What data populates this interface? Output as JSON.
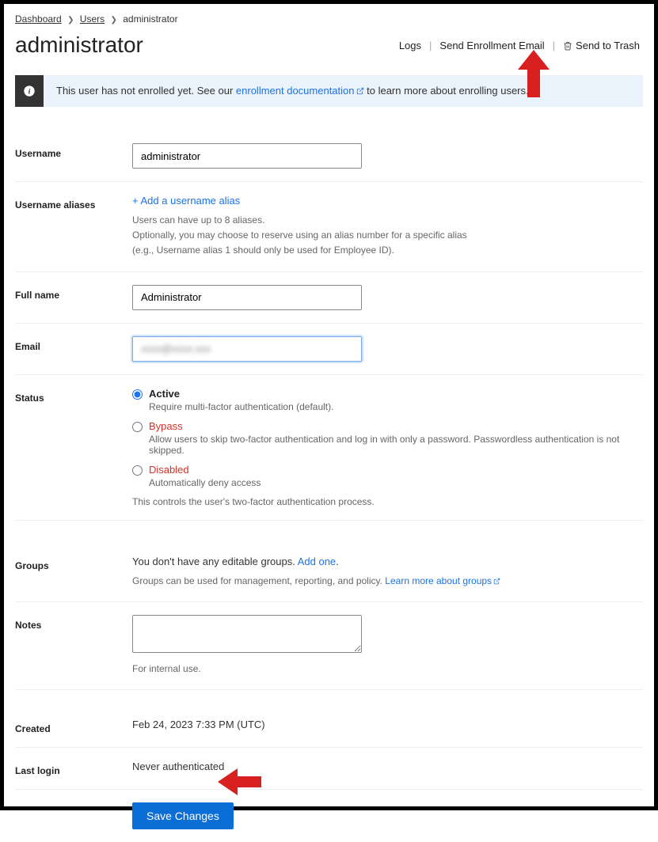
{
  "breadcrumb": {
    "dashboard": "Dashboard",
    "users": "Users",
    "current": "administrator"
  },
  "page_title": "administrator",
  "header_actions": {
    "logs": "Logs",
    "send_enrollment": "Send Enrollment Email",
    "send_trash": "Send to Trash"
  },
  "banner": {
    "prefix": "This user has not enrolled yet. See our ",
    "link": "enrollment documentation",
    "suffix": " to learn more about enrolling users."
  },
  "fields": {
    "username": {
      "label": "Username",
      "value": "administrator"
    },
    "aliases": {
      "label": "Username aliases",
      "add_link": "Add a username alias",
      "help1": "Users can have up to 8 aliases.",
      "help2": "Optionally, you may choose to reserve using an alias number for a specific alias",
      "help3": "(e.g., Username alias 1 should only be used for Employee ID)."
    },
    "fullname": {
      "label": "Full name",
      "value": "Administrator"
    },
    "email": {
      "label": "Email",
      "value_masked": "xxxx@xxxx.xxx"
    },
    "status": {
      "label": "Status",
      "active": {
        "label": "Active",
        "desc": "Require multi-factor authentication (default)."
      },
      "bypass": {
        "label": "Bypass",
        "desc": "Allow users to skip two-factor authentication and log in with only a password. Passwordless authentication is not skipped."
      },
      "disabled": {
        "label": "Disabled",
        "desc": "Automatically deny access"
      },
      "help": "This controls the user's two-factor authentication process."
    },
    "groups": {
      "label": "Groups",
      "text_prefix": "You don't have any editable groups. ",
      "add_one": "Add one",
      "help_prefix": "Groups can be used for management, reporting, and policy. ",
      "learn_more": "Learn more about groups"
    },
    "notes": {
      "label": "Notes",
      "help": "For internal use."
    },
    "created": {
      "label": "Created",
      "value": "Feb 24, 2023 7:33 PM (UTC)"
    },
    "last_login": {
      "label": "Last login",
      "value": "Never authenticated"
    }
  },
  "save_button": "Save Changes"
}
